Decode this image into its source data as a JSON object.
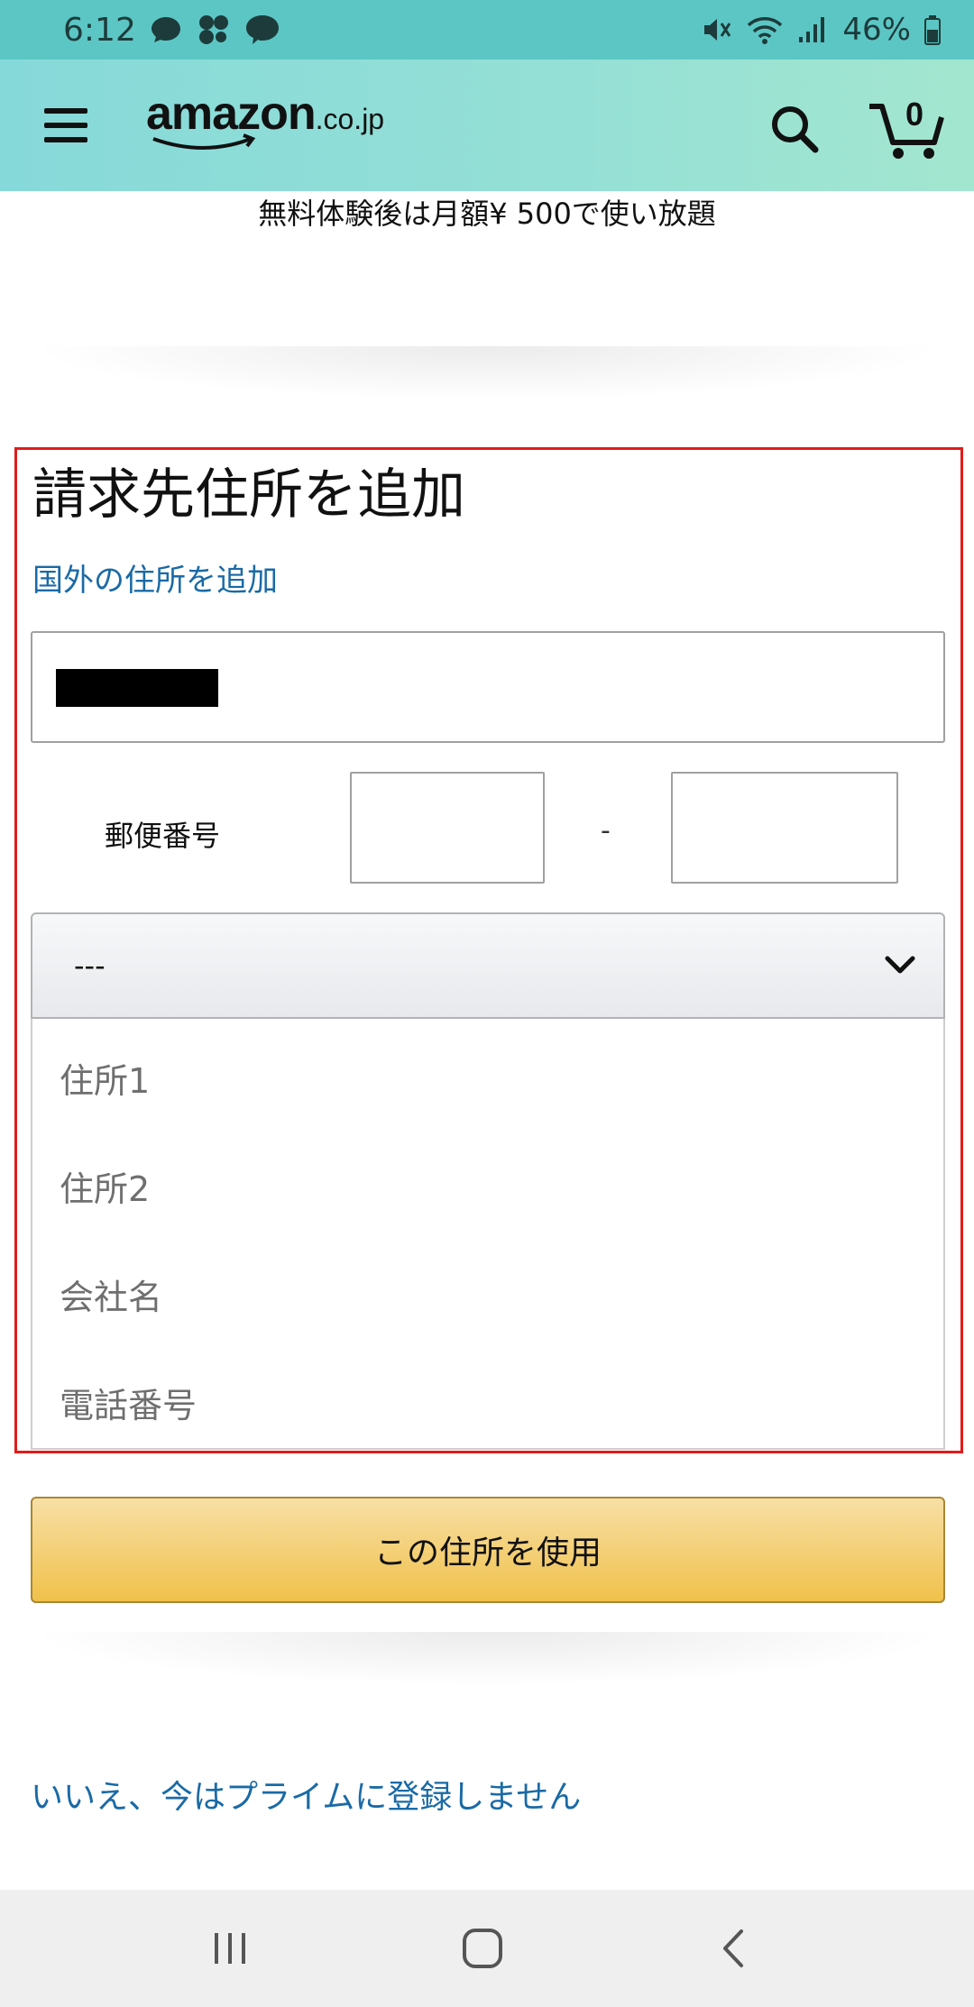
{
  "status_bar": {
    "time": "6:12",
    "battery": "46%",
    "icons_left": [
      "messenger-icon",
      "pinwheel-app-icon",
      "line-icon"
    ],
    "icons_right": [
      "mute-icon",
      "wifi-icon",
      "signal-icon",
      "battery-icon"
    ]
  },
  "header": {
    "logo_word": "amazon",
    "logo_tld": ".co.jp",
    "cart_count": "0",
    "background_colors": [
      "#86d9d9",
      "#a3e6cf"
    ]
  },
  "promo": {
    "text": "無料体験後は月額¥ 500で使い放題"
  },
  "form": {
    "title": "請求先住所を追加",
    "intl_link": "国外の住所を追加",
    "postal_label": "郵便番号",
    "postal_separator": "-",
    "prefecture_value": "---",
    "address1_placeholder": "住所1",
    "address2_placeholder": "住所2",
    "company_placeholder": "会社名",
    "phone_placeholder": "電話番号",
    "highlight_color": "#e01b1b"
  },
  "actions": {
    "use_address": "この住所を使用",
    "decline": "いいえ、今はプライムに登録しません"
  },
  "colors": {
    "link": "#1a6aa6",
    "button_top": "#f7dfa5",
    "button_bottom": "#f0c14b"
  }
}
